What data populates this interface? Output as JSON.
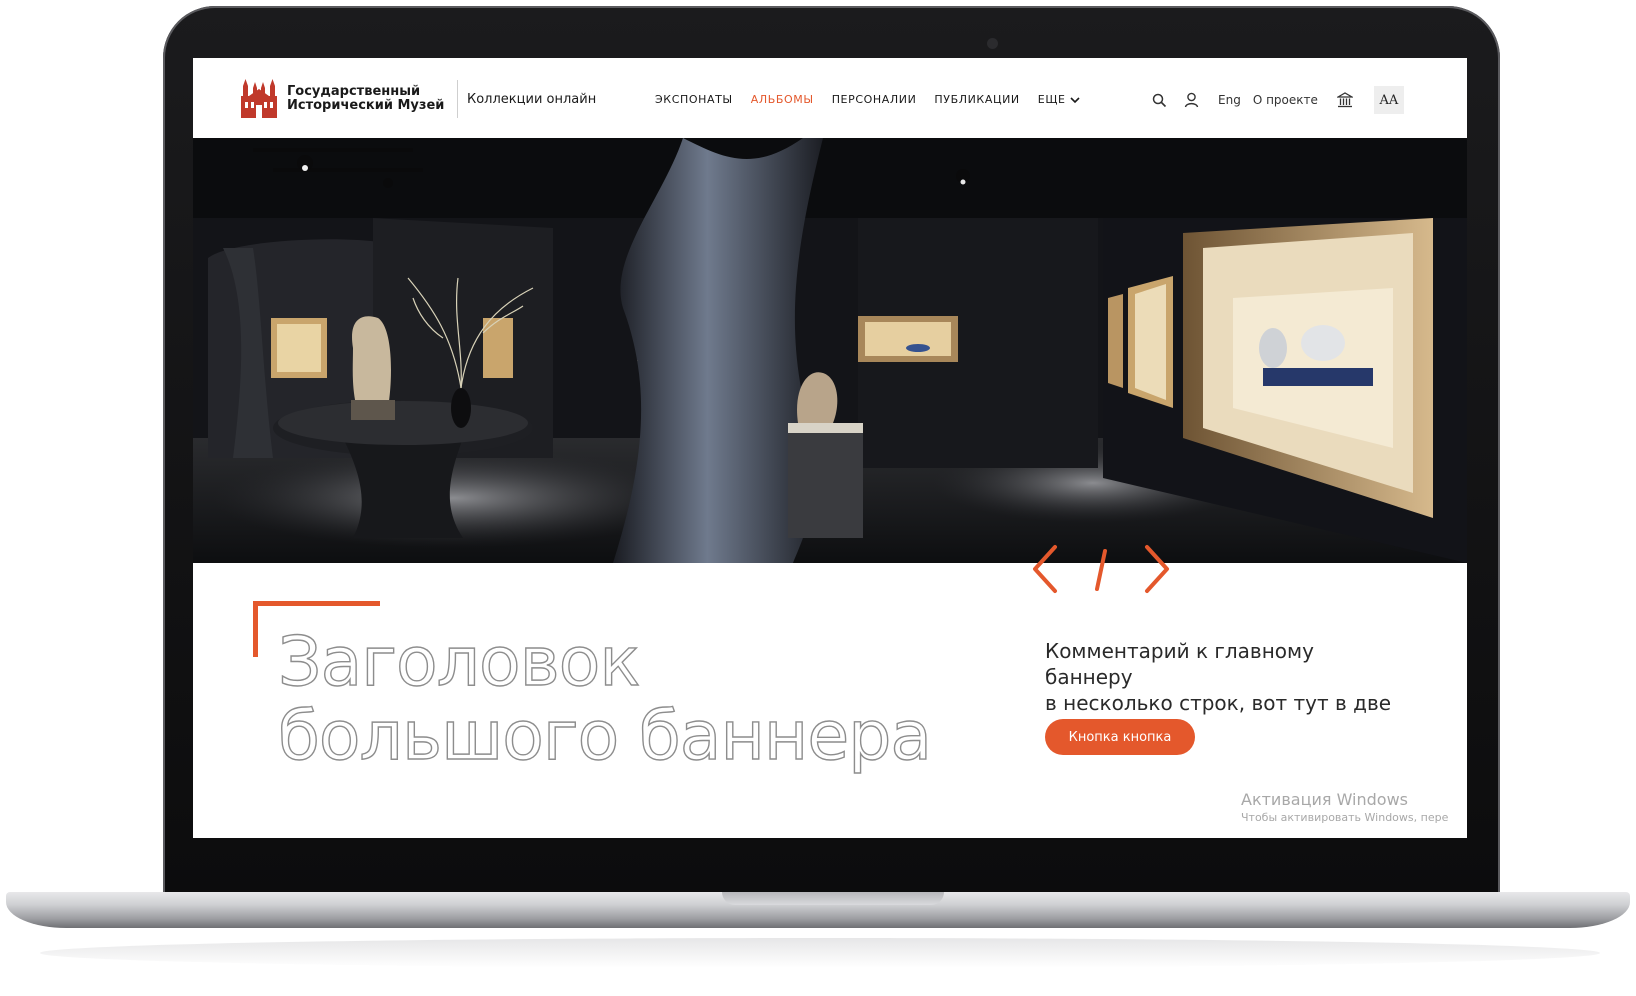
{
  "header": {
    "logo_line1": "Государственный",
    "logo_line2": "Исторический Музей",
    "collections_link": "Коллекции онлайн",
    "nav": [
      {
        "label": "ЭКСПОНАТЫ",
        "active": false
      },
      {
        "label": "АЛЬБОМЫ",
        "active": true
      },
      {
        "label": "ПЕРСОНАЛИИ",
        "active": false
      },
      {
        "label": "ПУБЛИКАЦИИ",
        "active": false
      },
      {
        "label": "ЕЩЕ",
        "active": false
      }
    ],
    "lang_label": "Eng",
    "about_label": "О проекте",
    "font_size_label": "AA"
  },
  "icons": {
    "search": "search-icon",
    "user": "user-icon",
    "museum": "museum-building-icon",
    "more": "chevron-down-icon",
    "prev": "chevron-left-icon",
    "next": "chevron-right-icon"
  },
  "banner": {
    "title_line1": "Заголовок",
    "title_line2": "большого баннера",
    "comment_line1": "Комментарий к главному баннеру",
    "comment_line2": "в несколько строк, вот тут в две",
    "button_label": "Кнопка кнопка"
  },
  "windows_activation": {
    "title": "Активация Windows",
    "subtitle": "Чтобы активировать Windows, пере"
  },
  "colors": {
    "accent": "#e4582c",
    "logo_red": "#c0392b",
    "text_dark": "#1a1a1a"
  }
}
